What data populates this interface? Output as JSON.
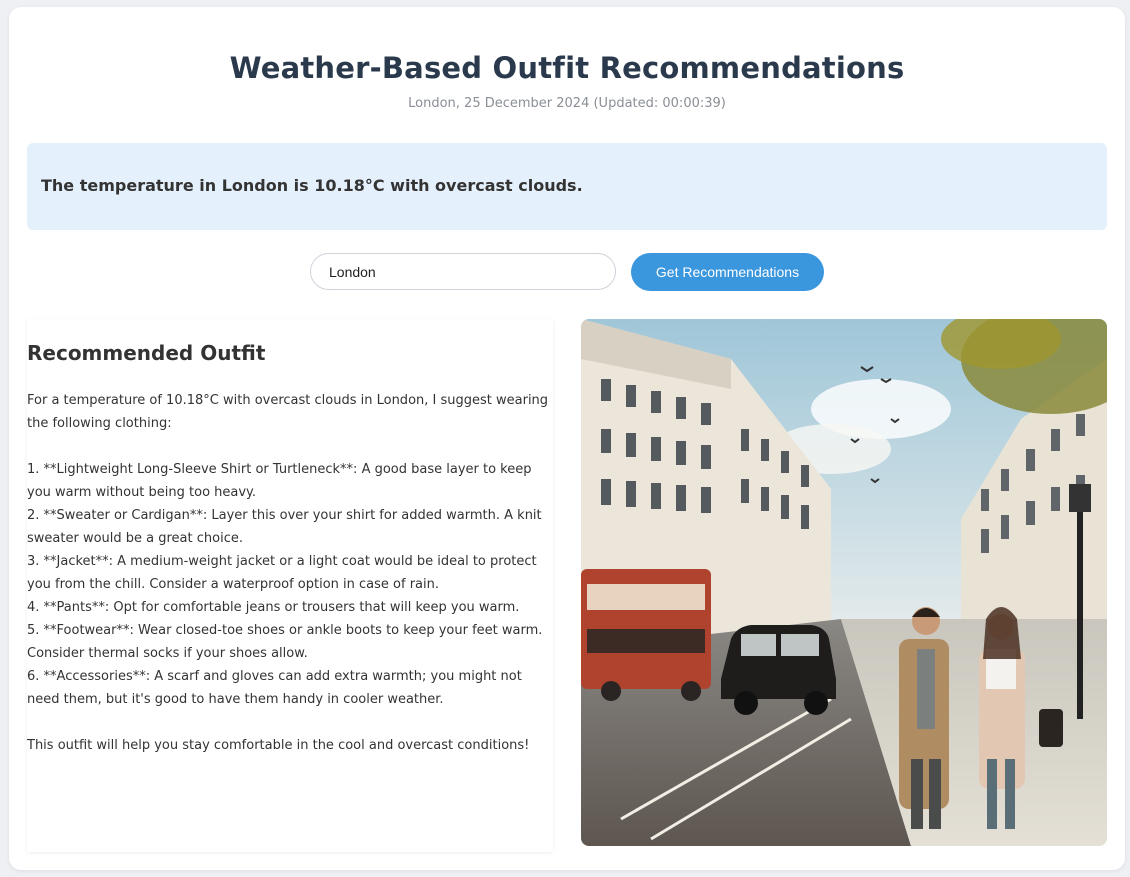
{
  "page": {
    "title": "Weather-Based Outfit Recommendations",
    "subtitle": "London, 25 December 2024 (Updated: 00:00:39)"
  },
  "weather": {
    "summary": "The temperature in London is 10.18°C with overcast clouds."
  },
  "search": {
    "value": "London",
    "button_label": "Get Recommendations"
  },
  "outfit": {
    "heading": "Recommended Outfit",
    "intro": "For a temperature of 10.18°C with overcast clouds in London, I suggest wearing the following clothing:",
    "items": [
      "1. **Lightweight Long-Sleeve Shirt or Turtleneck**: A good base layer to keep you warm without being too heavy.",
      "2. **Sweater or Cardigan**: Layer this over your shirt for added warmth. A knit sweater would be a great choice.",
      "3. **Jacket**: A medium-weight jacket or a light coat would be ideal to protect you from the chill. Consider a waterproof option in case of rain.",
      "4. **Pants**: Opt for comfortable jeans or trousers that will keep you warm.",
      "5. **Footwear**: Wear closed-toe shoes or ankle boots to keep your feet warm. Consider thermal socks if your shoes allow.",
      "6. **Accessories**: A scarf and gloves can add extra warmth; you might not need them, but it's good to have them handy in cooler weather."
    ],
    "closing": "This outfit will help you stay comfortable in the cool and overcast conditions!"
  },
  "colors": {
    "accent": "#3a96dd",
    "weather_box": "#e4f0fb",
    "title": "#2a3a4c"
  }
}
